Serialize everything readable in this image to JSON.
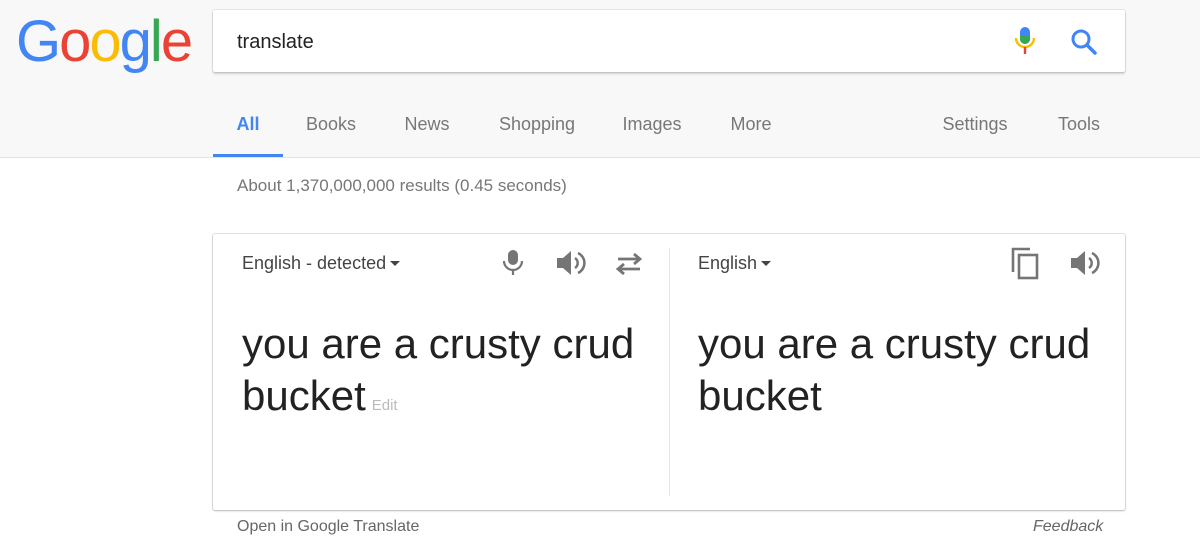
{
  "logo": {
    "letters": [
      {
        "char": "G",
        "color": "#4285F4"
      },
      {
        "char": "o",
        "color": "#EA4335"
      },
      {
        "char": "o",
        "color": "#FBBC05"
      },
      {
        "char": "g",
        "color": "#4285F4"
      },
      {
        "char": "l",
        "color": "#34A853"
      },
      {
        "char": "e",
        "color": "#EA4335"
      }
    ]
  },
  "search": {
    "query": "translate",
    "mic_icon": "mic-icon",
    "search_icon": "search-icon"
  },
  "tabs": {
    "all": "All",
    "books": "Books",
    "news": "News",
    "shopping": "Shopping",
    "images": "Images",
    "more": "More",
    "settings": "Settings",
    "tools": "Tools"
  },
  "results": {
    "stats": "About 1,370,000,000 results (0.45 seconds)"
  },
  "translate": {
    "source_lang": "English - detected",
    "target_lang": "English",
    "source_text": "you are a crusty crud bucket",
    "edit_label": "Edit",
    "target_text": "you are a crusty crud bucket",
    "icons": [
      "mic-icon",
      "speaker-icon",
      "swap-icon",
      "copy-icon",
      "speaker-icon"
    ]
  },
  "footer": {
    "open_link": "Open in Google Translate",
    "feedback": "Feedback"
  },
  "colors": {
    "accent": "#4285F4",
    "muted": "#777777"
  }
}
